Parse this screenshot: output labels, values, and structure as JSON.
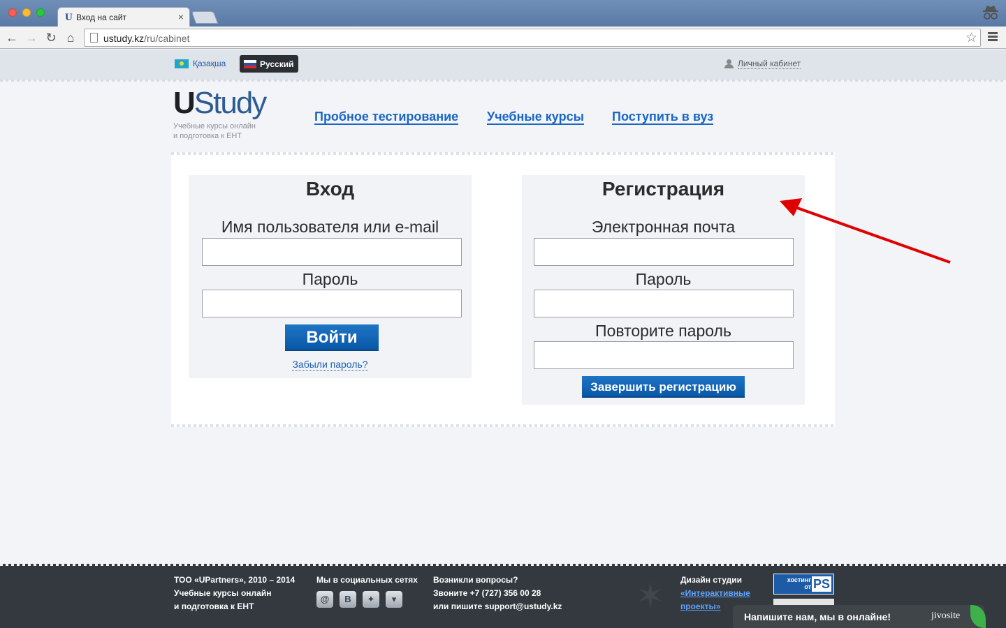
{
  "browser": {
    "tab_title": "Вход на сайт",
    "tab_favicon": "U",
    "url_host": "ustudy.kz",
    "url_path": "/ru/cabinet"
  },
  "topbar": {
    "lang_kz": "Қазақша",
    "lang_ru": "Русский",
    "cabinet": "Личный кабинет"
  },
  "header": {
    "logo_u": "U",
    "logo_rest": "Study",
    "tagline_1": "Учебные курсы онлайн",
    "tagline_2": "и подготовка к ЕНТ",
    "nav": [
      "Пробное тестирование",
      "Учебные курсы",
      "Поступить в вуз"
    ]
  },
  "login": {
    "title": "Вход",
    "username_label": "Имя пользователя или e-mail",
    "password_label": "Пароль",
    "submit": "Войти",
    "forgot": "Забыли пароль?"
  },
  "register": {
    "title": "Регистрация",
    "email_label": "Электронная почта",
    "password_label": "Пароль",
    "repeat_label": "Повторите пароль",
    "submit": "Завершить регистрацию"
  },
  "footer": {
    "company_1": "ТОО «UPartners», 2010 – 2014",
    "company_2": "Учебные курсы онлайн",
    "company_3": "и подготовка к ЕНТ",
    "social_title": "Мы в социальных сетях",
    "social_icons": [
      "@",
      "B",
      "twitter",
      "chat"
    ],
    "questions": "Возникли вопросы?",
    "phone": "Звоните +7 (727) 356 00 28",
    "email_prefix": "или пишите",
    "email": "support@ustudy.kz",
    "design_1": "Дизайн студии",
    "design_2": "«Интерактивные",
    "design_3": "проекты»",
    "hosting_1": "хостинг",
    "hosting_2": "от",
    "hosting_logo": "PS"
  },
  "chat": {
    "text": "Напишите нам, мы в онлайне!",
    "brand": "jivosite"
  },
  "colors": {
    "accent": "#1a66c4",
    "button": "#0a58a8",
    "footer": "#33393f",
    "annotation_arrow": "#e00000"
  }
}
